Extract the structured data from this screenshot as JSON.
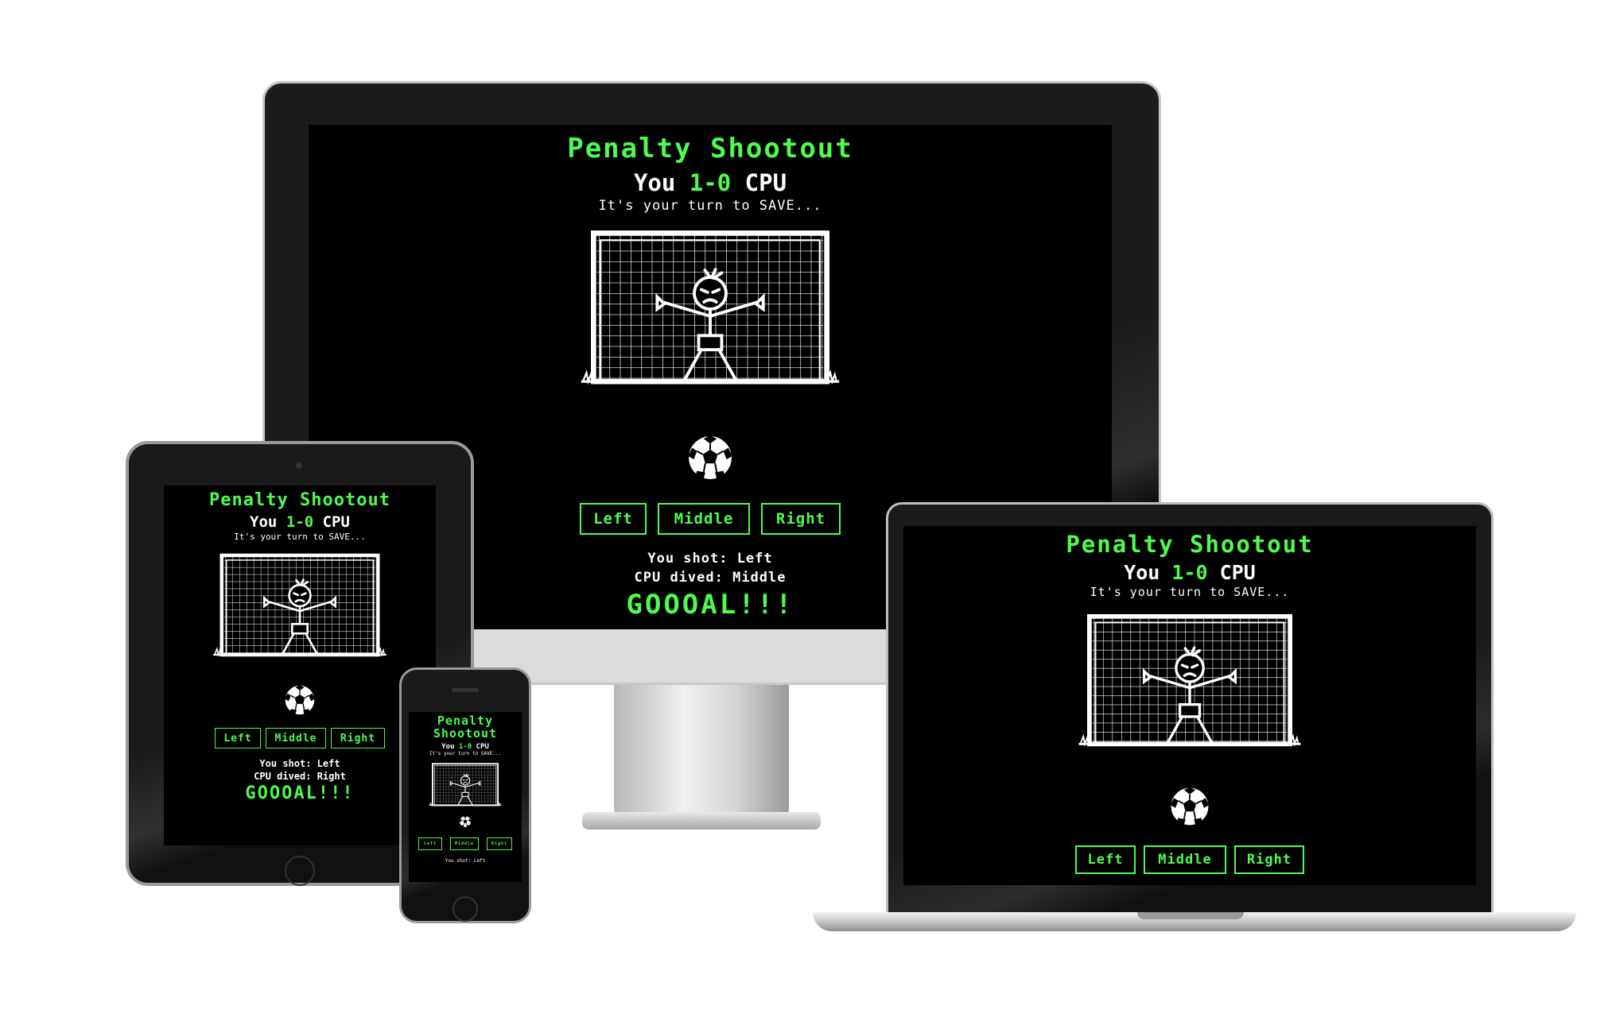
{
  "game": {
    "title": "Penalty Shootout",
    "title_line1": "Penalty",
    "title_line2": "Shootout",
    "score_you": "You",
    "score_value": "1-0",
    "score_cpu": "CPU",
    "turn_message": "It's your turn to SAVE...",
    "buttons": {
      "left": "Left",
      "middle": "Middle",
      "right": "Right"
    },
    "result_shot": "You shot: Left",
    "result_cpu_middle": "CPU dived: Middle",
    "result_cpu_right": "CPU dived: Right",
    "result_goal": "GOOOAL!!!"
  },
  "colors": {
    "accent": "#4dfc4d",
    "screen_bg": "#000000",
    "text": "#ffffff"
  },
  "icons": [
    "goal-net-icon",
    "goalkeeper-icon",
    "football-icon"
  ]
}
